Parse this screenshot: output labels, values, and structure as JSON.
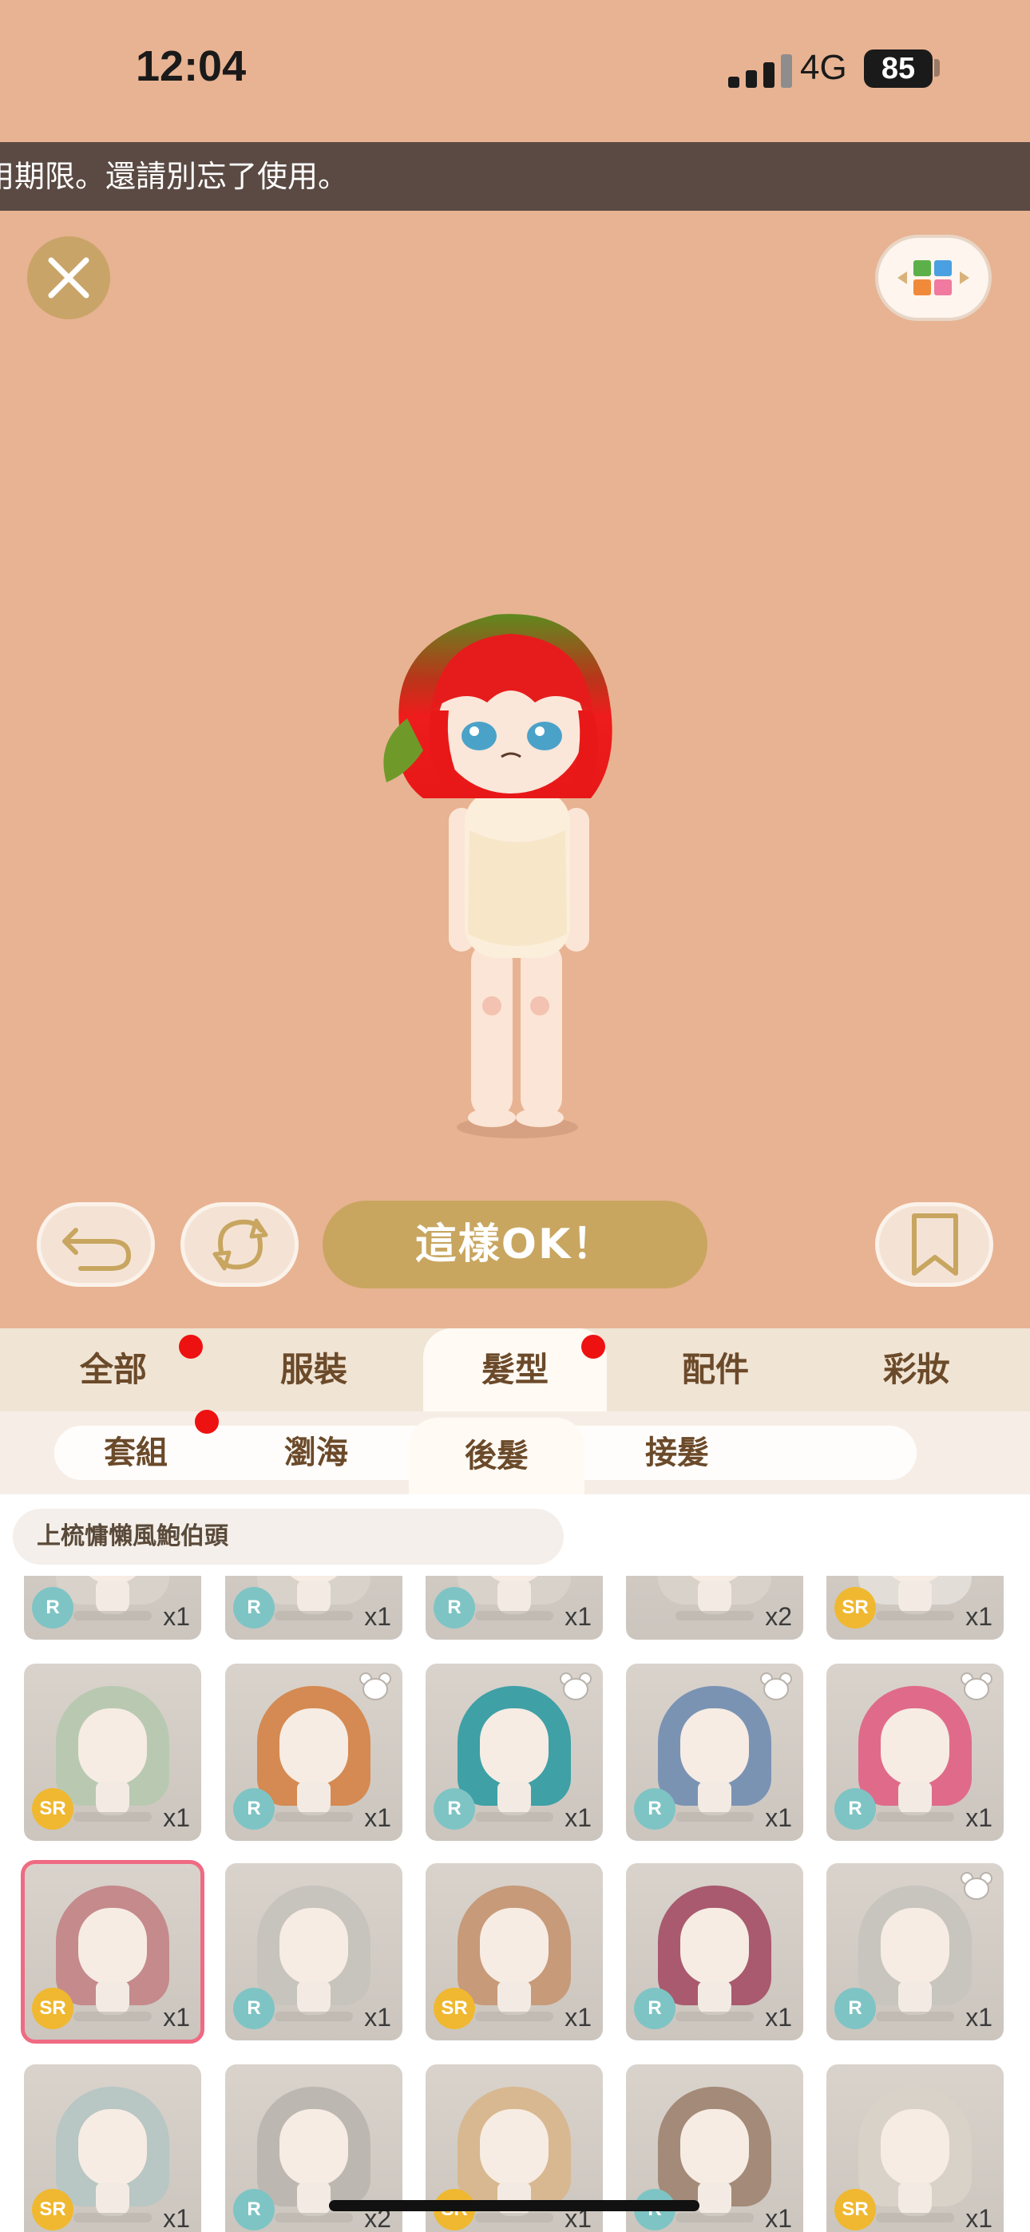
{
  "status": {
    "time": "12:04",
    "network": "4G",
    "battery": "85"
  },
  "notice": {
    "text": "用期限。還請別忘了使用。"
  },
  "actions": {
    "ok_label": "這樣OK！"
  },
  "tabs": [
    {
      "label": "全部",
      "active": false,
      "badge_dot": true
    },
    {
      "label": "服裝",
      "active": false,
      "badge_dot": false
    },
    {
      "label": "髮型",
      "active": true,
      "badge_dot": true
    },
    {
      "label": "配件",
      "active": false,
      "badge_dot": false
    },
    {
      "label": "彩妝",
      "active": false,
      "badge_dot": false
    }
  ],
  "subtabs": [
    {
      "label": "套組",
      "active": false,
      "badge_dot": true
    },
    {
      "label": "瀏海",
      "active": false,
      "badge_dot": false
    },
    {
      "label": "後髮",
      "active": true,
      "badge_dot": false
    },
    {
      "label": "接髮",
      "active": false,
      "badge_dot": false
    }
  ],
  "selected_item_name": "上梳慵懶風鮑伯頭",
  "items": [
    {
      "rarity": "R",
      "qty": "x1",
      "hair": "#d8d2cb",
      "bear": false,
      "selected": false
    },
    {
      "rarity": "R",
      "qty": "x1",
      "hair": "#d8d2cb",
      "bear": false,
      "selected": false
    },
    {
      "rarity": "R",
      "qty": "x1",
      "hair": "#d8d2cb",
      "bear": false,
      "selected": false
    },
    {
      "rarity": "",
      "qty": "x2",
      "hair": "#d8d2cb",
      "bear": false,
      "selected": false
    },
    {
      "rarity": "SR",
      "qty": "x1",
      "hair": "#e2ddd6",
      "bear": false,
      "selected": false
    },
    {
      "rarity": "SR",
      "qty": "x1",
      "hair": "#b9c9b1",
      "bear": false,
      "selected": false
    },
    {
      "rarity": "R",
      "qty": "x1",
      "hair": "#d48a52",
      "bear": true,
      "selected": false
    },
    {
      "rarity": "R",
      "qty": "x1",
      "hair": "#3fa0a6",
      "bear": true,
      "selected": false
    },
    {
      "rarity": "R",
      "qty": "x1",
      "hair": "#7b93b3",
      "bear": true,
      "selected": false
    },
    {
      "rarity": "R",
      "qty": "x1",
      "hair": "#e06a8a",
      "bear": true,
      "selected": false
    },
    {
      "rarity": "SR",
      "qty": "x1",
      "hair": "#c58a8c",
      "bear": false,
      "selected": true
    },
    {
      "rarity": "R",
      "qty": "x1",
      "hair": "#c7c3bd",
      "bear": false,
      "selected": false
    },
    {
      "rarity": "SR",
      "qty": "x1",
      "hair": "#c79a7a",
      "bear": false,
      "selected": false
    },
    {
      "rarity": "R",
      "qty": "x1",
      "hair": "#a95a6e",
      "bear": false,
      "selected": false
    },
    {
      "rarity": "R",
      "qty": "x1",
      "hair": "#c8c4be",
      "bear": true,
      "selected": false
    },
    {
      "rarity": "SR",
      "qty": "x1",
      "hair": "#b8c6c4",
      "bear": false,
      "selected": false
    },
    {
      "rarity": "R",
      "qty": "x2",
      "hair": "#bdb7b1",
      "bear": false,
      "selected": false
    },
    {
      "rarity": "SR",
      "qty": "x1",
      "hair": "#d8b890",
      "bear": false,
      "selected": false
    },
    {
      "rarity": "R",
      "qty": "x1",
      "hair": "#a48a78",
      "bear": false,
      "selected": false
    },
    {
      "rarity": "SR",
      "qty": "x1",
      "hair": "#d9d2c8",
      "bear": false,
      "selected": false
    }
  ],
  "colors": {
    "background": "#e8b392",
    "accent": "#c8a660",
    "selected_border": "#ef6a82"
  },
  "icons": [
    "close-icon",
    "palette-icon",
    "undo-icon",
    "refresh-icon",
    "bookmark-icon",
    "bear-icon"
  ]
}
